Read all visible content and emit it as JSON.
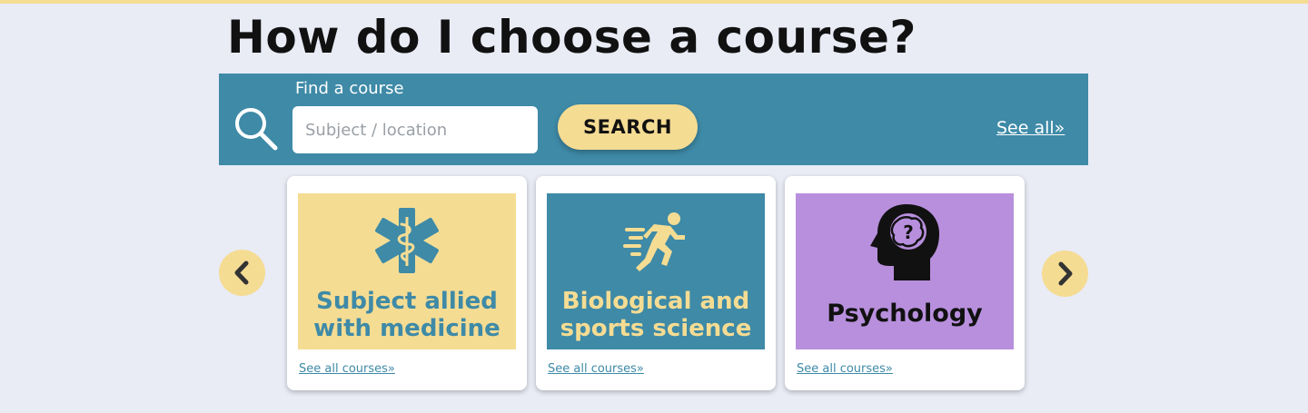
{
  "page": {
    "title": "How do I choose a course?"
  },
  "search": {
    "label": "Find a course",
    "placeholder": "Subject / location",
    "value": "",
    "button_label": "SEARCH",
    "see_all_label": "See all»"
  },
  "carousel": {
    "cards": [
      {
        "title": "Subject allied with medicine",
        "link": "See all courses»",
        "icon": "medical-star-of-life-icon"
      },
      {
        "title": "Biological and sports science",
        "link": "See all courses»",
        "icon": "running-person-icon"
      },
      {
        "title": "Psychology",
        "link": "See all courses»",
        "icon": "head-question-icon"
      }
    ]
  },
  "colors": {
    "background": "#e9ebf5",
    "accent_teal": "#3e8aa7",
    "accent_yellow": "#f5dc93",
    "accent_purple": "#b88fdd"
  }
}
